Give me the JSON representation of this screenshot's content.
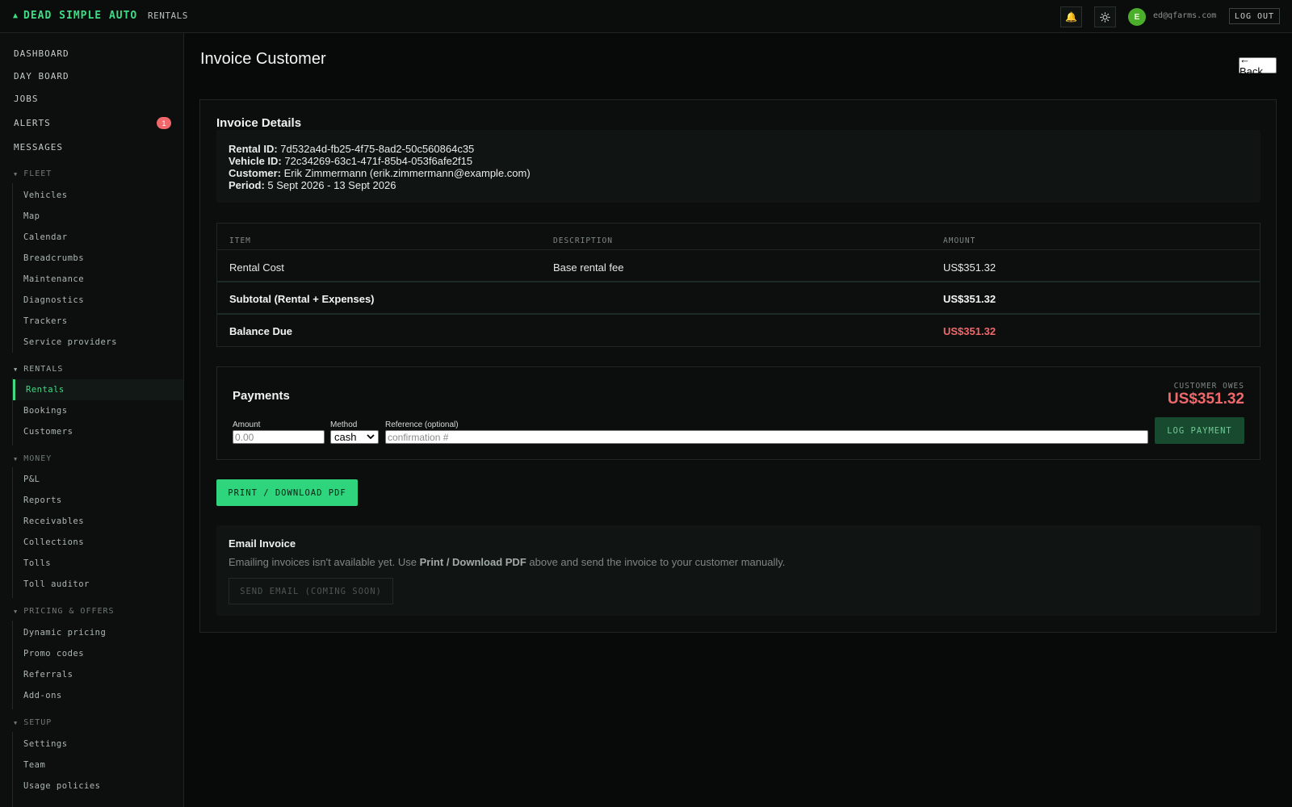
{
  "header": {
    "brand": "DEAD SIMPLE AUTO",
    "brand_icon": "car-icon",
    "nav": "RENTALS",
    "avatar_initial": "E",
    "user_email": "ed@qfarms.com",
    "logout_label": "LOG OUT"
  },
  "sidebar": {
    "main_links": [
      "DASHBOARD",
      "DAY BOARD",
      "JOBS",
      "ALERTS",
      "MESSAGES"
    ],
    "alerts_badge": "1",
    "fleet": {
      "title": "FLEET",
      "items": [
        "Vehicles",
        "Map",
        "Calendar",
        "Breadcrumbs",
        "Maintenance",
        "Diagnostics",
        "Trackers",
        "Service providers"
      ]
    },
    "rentals": {
      "title": "RENTALS",
      "items": [
        "Rentals",
        "Bookings",
        "Customers"
      ],
      "active": "Rentals"
    },
    "money": {
      "title": "MONEY",
      "items": [
        "P&L",
        "Reports",
        "Receivables",
        "Collections",
        "Tolls",
        "Toll auditor"
      ]
    },
    "pricing": {
      "title": "PRICING & OFFERS",
      "items": [
        "Dynamic pricing",
        "Promo codes",
        "Referrals",
        "Add-ons"
      ]
    },
    "setup": {
      "title": "SETUP",
      "items": [
        "Settings",
        "Team",
        "Usage policies"
      ]
    }
  },
  "page": {
    "title": "Invoice Customer",
    "back_label": "← Back"
  },
  "invoice": {
    "title": "Invoice Details",
    "rental_id_label": "Rental ID:",
    "rental_id": "7d532a4d-fb25-4f75-8ad2-50c560864c35",
    "vehicle_id_label": "Vehicle ID:",
    "vehicle_id": "72c34269-63c1-471f-85b4-053f6afe2f15",
    "customer_label": "Customer:",
    "customer": "Erik Zimmermann (erik.zimmermann@example.com)",
    "period_label": "Period:",
    "period": "5 Sept 2026 - 13 Sept 2026"
  },
  "table": {
    "headers": [
      "ITEM",
      "DESCRIPTION",
      "AMOUNT"
    ],
    "rows": [
      {
        "item": "Rental Cost",
        "description": "Base rental fee",
        "amount": "US$351.32"
      }
    ],
    "subtotal_label": "Subtotal (Rental + Expenses)",
    "subtotal": "US$351.32",
    "balance_label": "Balance Due",
    "balance": "US$351.32",
    "balance_color": "#f0686b"
  },
  "payments": {
    "title": "Payments",
    "owes_label": "CUSTOMER OWES",
    "owes_amount": "US$351.32",
    "amount_label": "Amount",
    "amount_placeholder": "0.00",
    "method_label": "Method",
    "method_value": "cash",
    "reference_label": "Reference (optional)",
    "reference_placeholder": "confirmation #",
    "log_label": "LOG PAYMENT"
  },
  "print_label": "PRINT / DOWNLOAD PDF",
  "email": {
    "title": "Email Invoice",
    "text_before": "Emailing invoices isn't available yet. Use ",
    "text_bold": "Print / Download PDF",
    "text_after": " above and send the invoice to your customer manually.",
    "button_label": "SEND EMAIL (COMING SOON)"
  },
  "colors": {
    "accent": "#3ddc84",
    "danger": "#f0686b",
    "background": "#080a09"
  }
}
